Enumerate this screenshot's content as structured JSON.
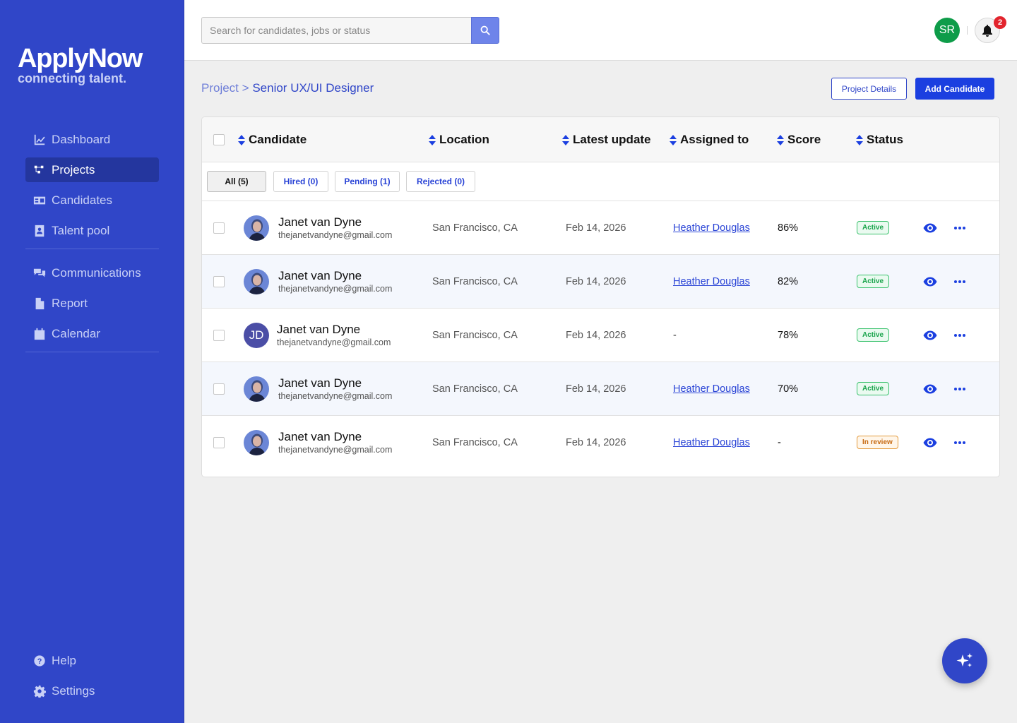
{
  "brand": {
    "name": "ApplyNow",
    "tagline": "connecting talent."
  },
  "sidebar": {
    "items": [
      {
        "label": "Dashboard",
        "icon": "chart-line-icon"
      },
      {
        "label": "Projects",
        "icon": "projects-icon",
        "active": true
      },
      {
        "label": "Candidates",
        "icon": "id-card-icon"
      },
      {
        "label": "Talent pool",
        "icon": "contact-book-icon"
      },
      {
        "label": "Communications",
        "icon": "comments-icon"
      },
      {
        "label": "Report",
        "icon": "file-icon"
      },
      {
        "label": "Calendar",
        "icon": "calendar-icon"
      }
    ],
    "footer": [
      {
        "label": "Help",
        "icon": "question-circle-icon"
      },
      {
        "label": "Settings",
        "icon": "gear-icon"
      }
    ]
  },
  "topbar": {
    "search_placeholder": "Search for candidates, jobs or status",
    "user_initials": "SR",
    "notification_count": "2"
  },
  "breadcrumb": {
    "parent": "Project",
    "separator": ">",
    "current": "Senior UX/UI Designer"
  },
  "actions": {
    "details": "Project Details",
    "add": "Add Candidate"
  },
  "table": {
    "columns": [
      "Candidate",
      "Location",
      "Latest update",
      "Assigned to",
      "Score",
      "Status"
    ],
    "filters": [
      "All (5)",
      "Hired (0)",
      "Pending (1)",
      "Rejected (0)"
    ],
    "rows": [
      {
        "name": "Janet van Dyne",
        "email": "thejanetvandyne@gmail.com",
        "location": "San Francisco, CA",
        "updated": "Feb 14, 2026",
        "assigned": "Heather Douglas",
        "score": "86%",
        "status": "Active",
        "avatar": "photo"
      },
      {
        "name": "Janet van Dyne",
        "email": "thejanetvandyne@gmail.com",
        "location": "San Francisco, CA",
        "updated": "Feb 14, 2026",
        "assigned": "Heather Douglas",
        "score": "82%",
        "status": "Active",
        "avatar": "photo"
      },
      {
        "name": "Janet van Dyne",
        "email": "thejanetvandyne@gmail.com",
        "location": "San Francisco, CA",
        "updated": "Feb 14, 2026",
        "assigned": "-",
        "score": "78%",
        "status": "Active",
        "avatar": "initials",
        "initials": "JD"
      },
      {
        "name": "Janet van Dyne",
        "email": "thejanetvandyne@gmail.com",
        "location": "San Francisco, CA",
        "updated": "Feb 14, 2026",
        "assigned": "Heather Douglas",
        "score": "70%",
        "status": "Active",
        "avatar": "photo"
      },
      {
        "name": "Janet van Dyne",
        "email": "thejanetvandyne@gmail.com",
        "location": "San Francisco, CA",
        "updated": "Feb 14, 2026",
        "assigned": "Heather Douglas",
        "score": "-",
        "status": "In review",
        "avatar": "photo"
      }
    ]
  },
  "colors": {
    "brand": "#3046c8",
    "primary": "#1b3fe0",
    "active": "#17a34a",
    "review": "#c76a12"
  }
}
